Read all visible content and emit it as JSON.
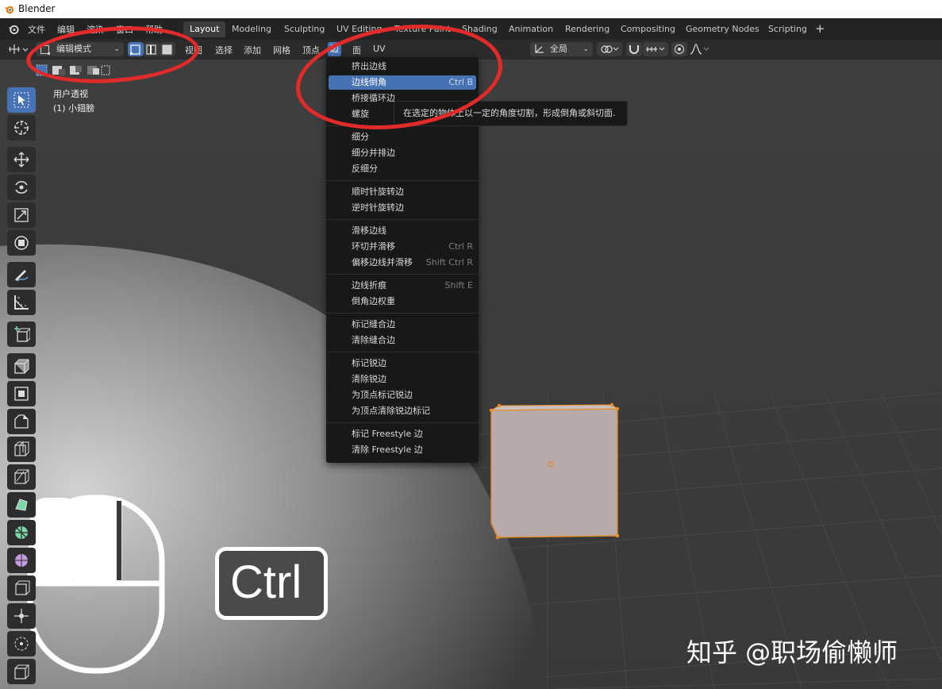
{
  "window": {
    "title": "Blender"
  },
  "top_menu": [
    "文件",
    "编辑",
    "渲染",
    "窗口",
    "帮助"
  ],
  "workspace_tabs": [
    {
      "label": "Layout",
      "active": true
    },
    {
      "label": "Modeling"
    },
    {
      "label": "Sculpting"
    },
    {
      "label": "UV Editing"
    },
    {
      "label": "Texture Paint"
    },
    {
      "label": "Shading"
    },
    {
      "label": "Animation"
    },
    {
      "label": "Rendering"
    },
    {
      "label": "Compositing"
    },
    {
      "label": "Geometry Nodes"
    },
    {
      "label": "Scripting"
    }
  ],
  "add_workspace": "+",
  "header": {
    "mode_label": "编辑模式",
    "menus": [
      "视图",
      "选择",
      "添加",
      "网格",
      "顶点",
      "边",
      "面",
      "UV"
    ],
    "active_menu": "边",
    "transform_orientation": "全局"
  },
  "viewport": {
    "view_name": "用户透视",
    "object_name": "(1) 小翅膀",
    "overlay_key": "Ctrl"
  },
  "edge_menu": {
    "groups": [
      [
        {
          "label": "挤出边线",
          "shortcut": ""
        },
        {
          "label": "边线倒角",
          "shortcut": "Ctrl B",
          "highlighted": true
        },
        {
          "label": "桥接循环边",
          "shortcut": ""
        },
        {
          "label": "螺旋",
          "shortcut": ""
        }
      ],
      [
        {
          "label": "细分",
          "shortcut": ""
        },
        {
          "label": "细分并排边",
          "shortcut": ""
        },
        {
          "label": "反细分",
          "shortcut": ""
        }
      ],
      [
        {
          "label": "顺时针旋转边",
          "shortcut": ""
        },
        {
          "label": "逆时针旋转边",
          "shortcut": ""
        }
      ],
      [
        {
          "label": "滑移边线",
          "shortcut": ""
        },
        {
          "label": "环切并滑移",
          "shortcut": "Ctrl R"
        },
        {
          "label": "偏移边线并滑移",
          "shortcut": "Shift Ctrl R"
        }
      ],
      [
        {
          "label": "边线折痕",
          "shortcut": "Shift E"
        },
        {
          "label": "倒角边权重",
          "shortcut": ""
        }
      ],
      [
        {
          "label": "标记缝合边",
          "shortcut": ""
        },
        {
          "label": "清除缝合边",
          "shortcut": ""
        }
      ],
      [
        {
          "label": "标记锐边",
          "shortcut": ""
        },
        {
          "label": "清除锐边",
          "shortcut": ""
        },
        {
          "label": "为顶点标记锐边",
          "shortcut": ""
        },
        {
          "label": "为顶点清除锐边标记",
          "shortcut": ""
        }
      ],
      [
        {
          "label": "标记 Freestyle 边",
          "shortcut": ""
        },
        {
          "label": "清除 Freestyle 边",
          "shortcut": ""
        }
      ]
    ]
  },
  "tooltip": "在选定的物体上以一定的角度切割，形成倒角或斜切面.",
  "watermark": "知乎 @职场偷懒师",
  "colors": {
    "accent": "#4772b3",
    "annotation_ring": "#e12a2a",
    "selection": "#f08a1e"
  }
}
